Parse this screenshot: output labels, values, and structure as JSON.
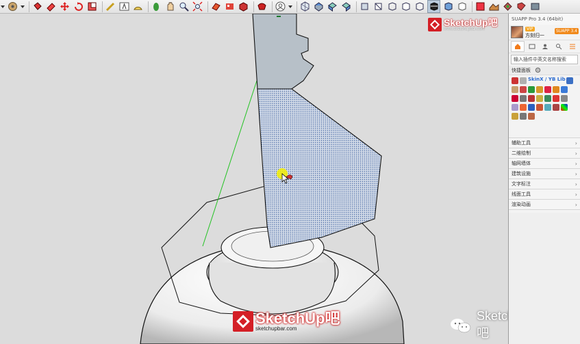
{
  "app": {
    "panel_title": "SUAPP Pro 3.4 (64bit)"
  },
  "toolbar": {
    "buttons": [
      "select-tool-icon",
      "orbit-tool-icon",
      "paint-bucket-icon",
      "eraser-icon",
      "move-tool-icon",
      "rotate-tool-icon",
      "scale-tool-icon",
      "tape-measure-icon",
      "text-tool-icon",
      "protractor-icon",
      "walk-icon",
      "pan-icon",
      "zoom-icon",
      "zoom-extents-icon",
      "section-plane-icon",
      "materials-icon",
      "components-icon",
      "styles-icon",
      "user-icon",
      "front-view-icon",
      "top-view-icon",
      "iso-view-icon",
      "right-view-icon",
      "back-view-icon",
      "left-view-icon",
      "xray-icon",
      "wireframe-icon",
      "hidden-line-icon",
      "shaded-icon",
      "textured-icon",
      "monochrome-icon",
      "solid-tools-icon",
      "sandbox-icon",
      "layout-icon",
      "extension-icon"
    ]
  },
  "viewport": {
    "logo_top": {
      "brand": "SketchUp吧",
      "url": "www.sketchupbar.com"
    },
    "logo_bottom": {
      "brand": "SketchUp吧",
      "url": "sketchupbar.com"
    },
    "watermark": {
      "label": "SketchUp吧"
    }
  },
  "panel": {
    "user": {
      "vip": "VIP",
      "name": "方刻归一",
      "app_button": "SUAPP 3.4"
    },
    "tabs": [
      "home-icon",
      "list-icon",
      "user-icon",
      "search-icon",
      "menu-icon"
    ],
    "search_placeholder": "输入插件中英文名称搜索",
    "quick_panel": "快捷面板",
    "skin_label": "SkinX / YB Lib",
    "categories": [
      "辅助工具",
      "二维绘制",
      "轴网墙体",
      "建筑设施",
      "文字标注",
      "线面工具",
      "渲染动画"
    ]
  },
  "colors": {
    "selection_fill": "#cfd8e6",
    "selection_dots": "#4d6ea8",
    "face_gray": "#b7c0c8",
    "brand_red": "#d41f26",
    "guide_green": "#22c322"
  }
}
